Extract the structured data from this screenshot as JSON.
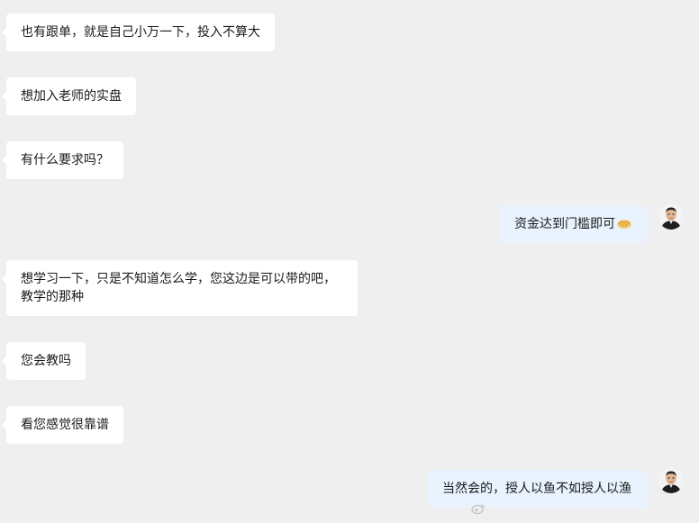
{
  "conversation": {
    "messages": [
      {
        "side": "left",
        "text": "也有跟单，就是自己小万一下，投入不算大"
      },
      {
        "side": "left",
        "text": "想加入老师的实盘"
      },
      {
        "side": "left",
        "text": "有什么要求吗？"
      },
      {
        "side": "right",
        "text": "资金达到门槛即可",
        "emoji": "handshake-emoji"
      },
      {
        "side": "left",
        "lines": [
          "想学习一下，只是不知道怎么学，您这边是可以带的吧，",
          "教学的那种"
        ]
      },
      {
        "side": "left",
        "text": "您会教吗"
      },
      {
        "side": "left",
        "text": "看您感觉很靠谱"
      },
      {
        "side": "right",
        "text": "当然会的，授人以鱼不如授人以渔"
      }
    ]
  },
  "colors": {
    "background": "#efefef",
    "left_bubble": "#ffffff",
    "right_bubble": "#e8f3fd"
  },
  "icons": {
    "avatar": "user-avatar",
    "handshake": "handshake-emoji",
    "watermark": "weibo-logo"
  }
}
